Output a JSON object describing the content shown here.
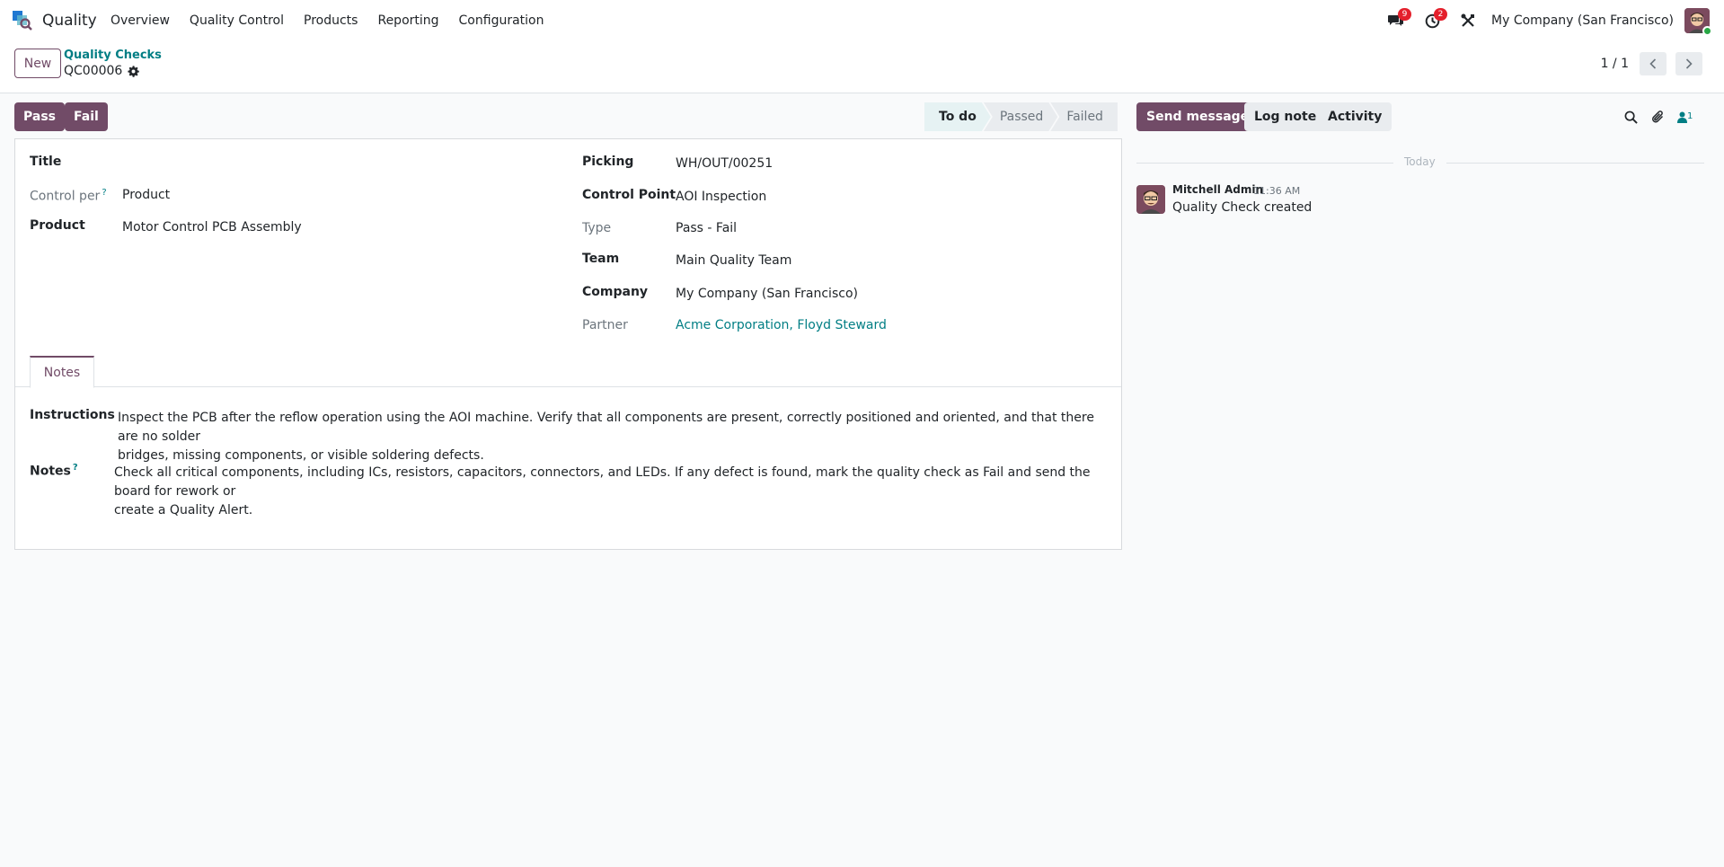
{
  "navbar": {
    "app_name": "Quality",
    "menu": [
      "Overview",
      "Quality Control",
      "Products",
      "Reporting",
      "Configuration"
    ],
    "messages_badge": "9",
    "activities_badge": "2",
    "company": "My Company (San Francisco)"
  },
  "control_panel": {
    "new_label": "New",
    "breadcrumb": "Quality Checks",
    "record_name": "QC00006",
    "pager": "1 / 1"
  },
  "statusbar": {
    "pass_label": "Pass",
    "fail_label": "Fail",
    "stages": [
      "To do",
      "Passed",
      "Failed"
    ],
    "current_stage": "To do"
  },
  "form": {
    "title_label": "Title",
    "control_per_label": "Control per",
    "control_per_value": "Product",
    "product_label": "Product",
    "product_value": "Motor Control PCB Assembly",
    "picking_label": "Picking",
    "picking_value": "WH/OUT/00251",
    "control_point_label": "Control Point",
    "control_point_value": "AOI Inspection",
    "type_label": "Type",
    "type_value": "Pass - Fail",
    "team_label": "Team",
    "team_value": "Main Quality Team",
    "company_label": "Company",
    "company_value": "My Company (San Francisco)",
    "partner_label": "Partner",
    "partner_value": "Acme Corporation, Floyd Steward",
    "help_mark": "?",
    "tab_notes": "Notes",
    "instructions_label": "Instructions",
    "instructions_line1": "Inspect the PCB after the reflow operation using the AOI machine. Verify that all components are present, correctly positioned and oriented, and that there are no solder",
    "instructions_line2": "bridges, missing components, or visible soldering defects.",
    "notes_label": "Notes",
    "notes_line1": "Check all critical components, including ICs, resistors, capacitors, connectors, and LEDs. If any defect is found, mark the quality check as Fail and send the board for rework or",
    "notes_line2": "create a Quality Alert."
  },
  "chatter": {
    "send_message": "Send message",
    "log_note": "Log note",
    "activity": "Activity",
    "followers_count": "1",
    "date_separator": "Today",
    "message": {
      "author": "Mitchell Admin",
      "time": "11:36 AM",
      "body": "Quality Check created"
    }
  },
  "colors": {
    "brand": "#714b67",
    "link": "#017e84",
    "badge": "#e4202c"
  }
}
